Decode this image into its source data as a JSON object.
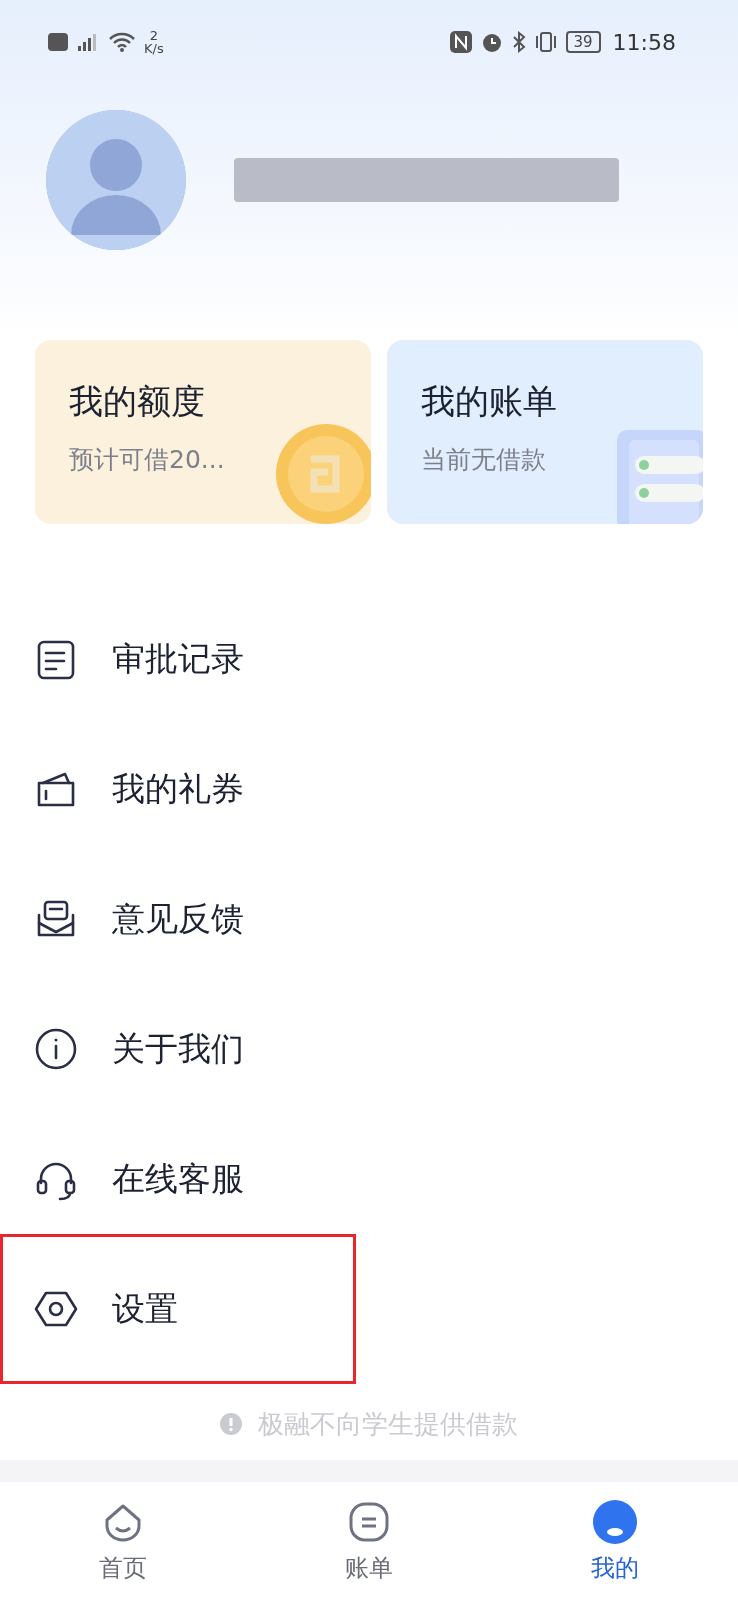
{
  "status_bar": {
    "speed_value": "2",
    "speed_unit": "K/s",
    "battery": "39",
    "time": "11:58"
  },
  "cards": [
    {
      "title": "我的额度",
      "subtitle": "预计可借20...",
      "kind": "coin"
    },
    {
      "title": "我的账单",
      "subtitle": "当前无借款",
      "kind": "bill"
    }
  ],
  "menu": [
    {
      "label": "审批记录",
      "kind": "record",
      "highlighted": false
    },
    {
      "label": "我的礼券",
      "kind": "coupon",
      "highlighted": false
    },
    {
      "label": "意见反馈",
      "kind": "feedback",
      "highlighted": false
    },
    {
      "label": "关于我们",
      "kind": "about",
      "highlighted": false
    },
    {
      "label": "在线客服",
      "kind": "service",
      "highlighted": false
    },
    {
      "label": "设置",
      "kind": "settings",
      "highlighted": true
    }
  ],
  "notice": "极融不向学生提供借款",
  "tabs": [
    {
      "label": "首页",
      "kind": "home",
      "selected": false
    },
    {
      "label": "账单",
      "kind": "bill",
      "selected": false
    },
    {
      "label": "我的",
      "kind": "mine",
      "selected": true
    }
  ]
}
